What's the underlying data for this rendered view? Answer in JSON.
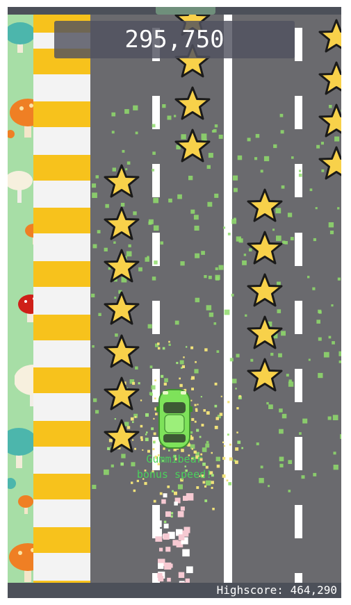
{
  "score": "295,750",
  "highscore": {
    "label": "Highscore:",
    "value": "464,290"
  },
  "bonus_message": {
    "line1": "Gummibear",
    "line2": "bonus speed!"
  },
  "colors": {
    "road": "#6a6a6e",
    "grass": "#a7dea6",
    "crosswalk_yellow": "#f7c21c",
    "crosswalk_white": "#f3f3f3",
    "star_fill": "#f8d14a",
    "car": "#7ee25a",
    "particle_green": "#8fdc6c",
    "bonus_text": "#4bd15b"
  },
  "icons": {
    "car": "sports-car-icon",
    "star": "star-icon",
    "mushroom": "mushroom-icon"
  }
}
